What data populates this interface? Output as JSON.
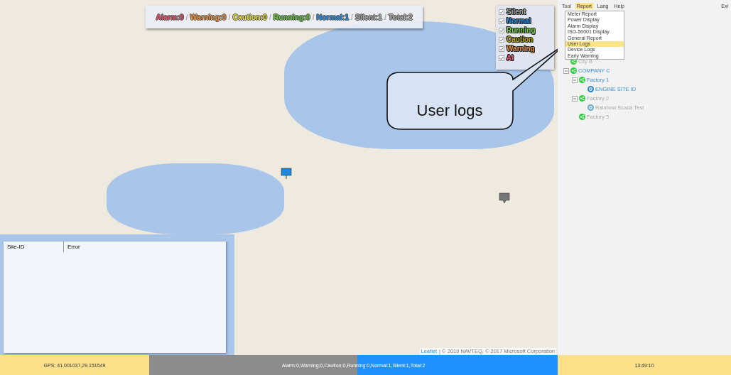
{
  "summary": [
    {
      "label": "Alarm:0",
      "color": "#e0506a"
    },
    {
      "sep": "/",
      "label": "Warning:0",
      "color": "#e8913a"
    },
    {
      "sep": "/",
      "label": "Caution:0",
      "color": "#e8e03a"
    },
    {
      "sep": "/",
      "label": "Running:0",
      "color": "#5cbf3a"
    },
    {
      "sep": "/",
      "label": "Normal:1",
      "color": "#2a8fe0"
    },
    {
      "sep": "/",
      "label": "Silent:1",
      "color": "#a8a8a8"
    },
    {
      "sep": "/",
      "label": "Total:2",
      "color": "#a8a8a8"
    }
  ],
  "legend": [
    {
      "label": "Silent",
      "checked": true,
      "color": "#a8a8a8"
    },
    {
      "label": "Normal",
      "checked": true,
      "color": "#2a8fe0"
    },
    {
      "label": "Running",
      "checked": true,
      "color": "#7cd04a"
    },
    {
      "label": "Caution",
      "checked": true,
      "color": "#b8a800"
    },
    {
      "label": "Warning",
      "checked": true,
      "color": "#e0904a"
    },
    {
      "label": "Al",
      "checked": true,
      "color": "#e0506a"
    }
  ],
  "map_markers": [
    {
      "kind": "square",
      "color": "#1e88d8"
    },
    {
      "kind": "bubble",
      "color": "#777777"
    }
  ],
  "site_table": {
    "columns": [
      "Site-ID",
      "Error"
    ]
  },
  "attribution": {
    "link": "Leaflet",
    "text": "| © 2010 NAVTEQ, © 2017 Microsoft Corporation"
  },
  "callout": {
    "text": "User logs"
  },
  "menubar": {
    "items": [
      {
        "label": "Tool",
        "selected": false
      },
      {
        "label": "Report",
        "selected": true
      },
      {
        "label": "Lang",
        "selected": false
      },
      {
        "label": "Help",
        "selected": false
      }
    ],
    "exit": "Exi"
  },
  "report_menu": [
    {
      "label": "Meter Report",
      "selected": false
    },
    {
      "label": "Power Display",
      "selected": false
    },
    {
      "label": "Alarm Display",
      "selected": false
    },
    {
      "label": "ISO-50001 Display",
      "selected": false
    },
    {
      "label": "General Report",
      "selected": false
    },
    {
      "label": "User Logs",
      "selected": true
    },
    {
      "label": "Device Logs",
      "selected": false
    },
    {
      "label": "Early Warning",
      "selected": false
    }
  ],
  "tree": [
    {
      "label": "City B",
      "kind": "group",
      "active": false
    },
    {
      "label": "COMPANY C",
      "kind": "group",
      "active": true,
      "expanded": true,
      "children": [
        {
          "label": "Factory 1",
          "kind": "group",
          "active": true,
          "expanded": true,
          "children": [
            {
              "label": "ENGINE SITE ID",
              "kind": "site",
              "active": true
            }
          ]
        },
        {
          "label": "Factory 2",
          "kind": "group",
          "active": false,
          "expanded": true,
          "children": [
            {
              "label": "Rainbow Scada Test",
              "kind": "site",
              "active": false
            }
          ]
        },
        {
          "label": "Factory 3",
          "kind": "group",
          "active": false
        }
      ]
    }
  ],
  "status_bar": {
    "gps": "GPS: 41.001037,29.151549",
    "counts": "Alarm:0,Warning:0,Caution:0,Running:0,Normal:1,Silent:1,Total:2",
    "level": 0.51,
    "time": "13:49:10"
  }
}
